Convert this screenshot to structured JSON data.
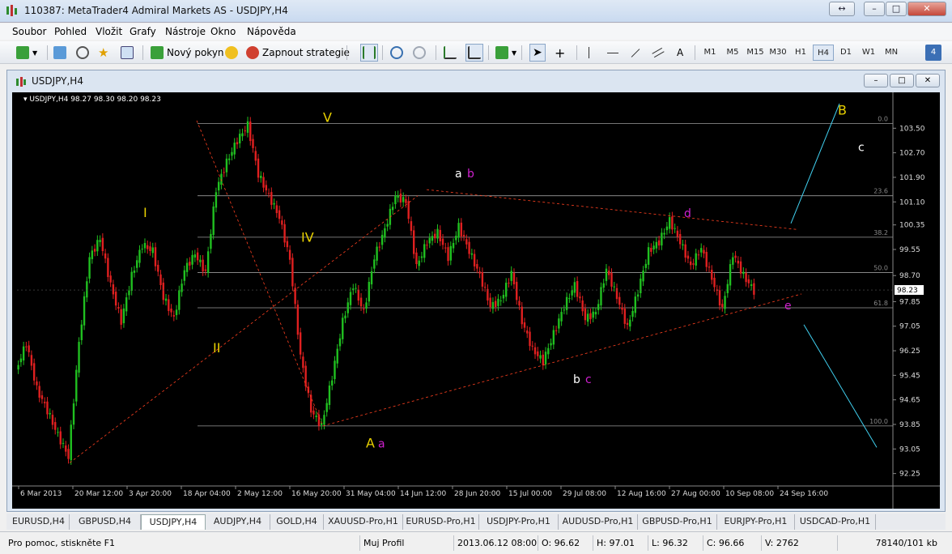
{
  "window": {
    "title": "110387: MetaTrader4 Admiral Markets AS - USDJPY,H4"
  },
  "menu": [
    "Soubor",
    "Pohled",
    "Vložit",
    "Grafy",
    "Nástroje",
    "Okno",
    "Nápověda"
  ],
  "toolbar": {
    "new_order": "Nový pokyn",
    "autotrading": "Zapnout strategie",
    "text_tool": "A",
    "timeframes": [
      "M1",
      "M5",
      "M15",
      "M30",
      "H1",
      "H4",
      "D1",
      "W1",
      "MN"
    ],
    "active_timeframe": "H4",
    "badge": "4"
  },
  "chart_window": {
    "title": "USDJPY,H4",
    "header": "USDJPY,H4  98.27 98.30 98.20 98.23"
  },
  "chart_data": {
    "type": "line",
    "title": "",
    "symbol": "USDJPY,H4",
    "ohlc_header": "98.27 98.30 98.20 98.23",
    "current_price": "98.23",
    "y_ticks": [
      "103.50",
      "102.70",
      "101.90",
      "101.10",
      "100.35",
      "99.55",
      "98.70",
      "97.85",
      "97.05",
      "96.25",
      "95.45",
      "94.65",
      "93.85",
      "93.05",
      "92.25"
    ],
    "x_ticks": [
      "6 Mar 2013",
      "20 Mar 12:00",
      "3 Apr 20:00",
      "18 Apr 04:00",
      "2 May 12:00",
      "16 May 20:00",
      "31 May 04:00",
      "14 Jun 12:00",
      "28 Jun 20:00",
      "15 Jul 00:00",
      "29 Jul 08:00",
      "12 Aug 16:00",
      "27 Aug 00:00",
      "10 Sep 08:00",
      "24 Sep 16:00"
    ],
    "ylim": [
      91.95,
      104.3
    ],
    "series": [
      {
        "values": [
          95.6,
          96.5,
          95.0,
          94.3,
          93.5,
          92.8,
          96.5,
          99.3,
          99.9,
          98.4,
          97.2,
          98.7,
          99.7,
          99.5,
          98.0,
          97.3,
          98.9,
          99.4,
          98.8,
          101.5,
          102.4,
          103.1,
          103.6,
          102.0,
          101.3,
          100.6,
          99.2,
          96.1,
          94.3,
          93.8,
          95.4,
          97.2,
          98.4,
          97.5,
          99.3,
          100.2,
          101.3,
          101.1,
          99.0,
          99.8,
          100.1,
          99.3,
          100.3,
          99.5,
          98.7,
          97.7,
          97.9,
          98.8,
          97.2,
          96.3,
          95.9,
          96.8,
          97.7,
          98.4,
          97.3,
          97.5,
          98.9,
          98.0,
          97.0,
          98.2,
          99.5,
          99.8,
          100.5,
          99.8,
          99.0,
          99.6,
          98.6,
          97.6,
          99.4,
          98.7,
          98.2
        ]
      }
    ],
    "fib_levels": [
      {
        "label": "0.0",
        "price": 103.65
      },
      {
        "label": "23.6",
        "price": 101.3
      },
      {
        "label": "38.2",
        "price": 99.95
      },
      {
        "label": "50.0",
        "price": 98.8
      },
      {
        "label": "61.8",
        "price": 97.65
      },
      {
        "label": "100.0",
        "price": 93.8
      }
    ],
    "wave_labels": [
      {
        "text": "V",
        "color": "#e8d000"
      },
      {
        "text": "I",
        "color": "#e8d000"
      },
      {
        "text": "IV",
        "color": "#e8d000"
      },
      {
        "text": "II",
        "color": "#e8d000"
      },
      {
        "text": "A",
        "color": "#e8d000"
      },
      {
        "text": "a",
        "color": "#d020d0"
      },
      {
        "text": "a",
        "color": "#ffffff"
      },
      {
        "text": "b",
        "color": "#d020d0"
      },
      {
        "text": "d",
        "color": "#d020d0"
      },
      {
        "text": "b",
        "color": "#ffffff"
      },
      {
        "text": "c",
        "color": "#d020d0"
      },
      {
        "text": "e",
        "color": "#d020d0"
      },
      {
        "text": "B",
        "color": "#e8d000"
      },
      {
        "text": "c",
        "color": "#ffffff"
      }
    ],
    "colors": {
      "background": "#000000",
      "bull": "#20c020",
      "bear": "#e02020",
      "fib": "#9a9a9a",
      "trend": "#ff4020",
      "projection": "#40d0f0"
    },
    "grid": false
  },
  "symbol_tabs": [
    "EURUSD,H4",
    "GBPUSD,H4",
    "USDJPY,H4",
    "AUDJPY,H4",
    "GOLD,H4",
    "XAUUSD-Pro,H1",
    "EURUSD-Pro,H1",
    "USDJPY-Pro,H1",
    "AUDUSD-Pro,H1",
    "GBPUSD-Pro,H1",
    "EURJPY-Pro,H1",
    "USDCAD-Pro,H1"
  ],
  "active_tab": "USDJPY,H4",
  "statusbar": {
    "help": "Pro pomoc, stiskněte F1",
    "profile": "Muj Profil",
    "datetime": "2013.06.12 08:00",
    "open": "O: 96.62",
    "high": "H: 97.01",
    "low": "L: 96.32",
    "close": "C: 96.66",
    "volume": "V: 2762",
    "traffic": "78140/101 kb"
  }
}
